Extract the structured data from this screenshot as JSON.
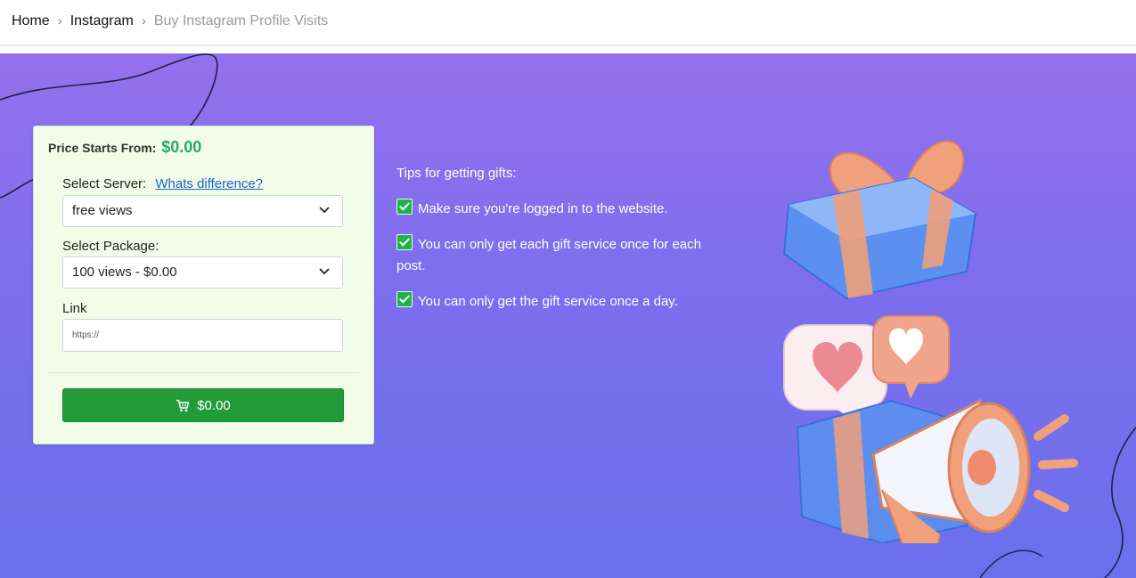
{
  "breadcrumb": {
    "items": [
      {
        "label": "Home"
      },
      {
        "label": "Instagram"
      }
    ],
    "current": "Buy Instagram Profile Visits",
    "separator": "›"
  },
  "order_form": {
    "price_label": "Price Starts From:",
    "price_value": "$0.00",
    "server_label": "Select Server:",
    "server_link": "Whats difference?",
    "server_value": "free views",
    "package_label": "Select Package:",
    "package_value": "100 views - $0.00",
    "link_label": "Link",
    "link_placeholder": "https://",
    "link_value": "",
    "buy_label": "$0.00"
  },
  "tips": {
    "title": "Tips for getting gifts:",
    "items": [
      "Make sure you're logged in to the website.",
      "You can only get each gift service once for each post.",
      "You can only get the gift service once a day."
    ]
  },
  "colors": {
    "hero_top": "#9570ec",
    "hero_bottom": "#6a70ec",
    "card_bg": "#f1fce9",
    "price_green": "#28a86b",
    "button_green": "#239b3b",
    "link_blue": "#1b64c8",
    "check_green": "#1fb14a"
  },
  "icons": {
    "separator": "chevron-right-icon",
    "select": "chevron-down-icon",
    "button": "cart-icon",
    "tip": "checkmark-icon"
  }
}
